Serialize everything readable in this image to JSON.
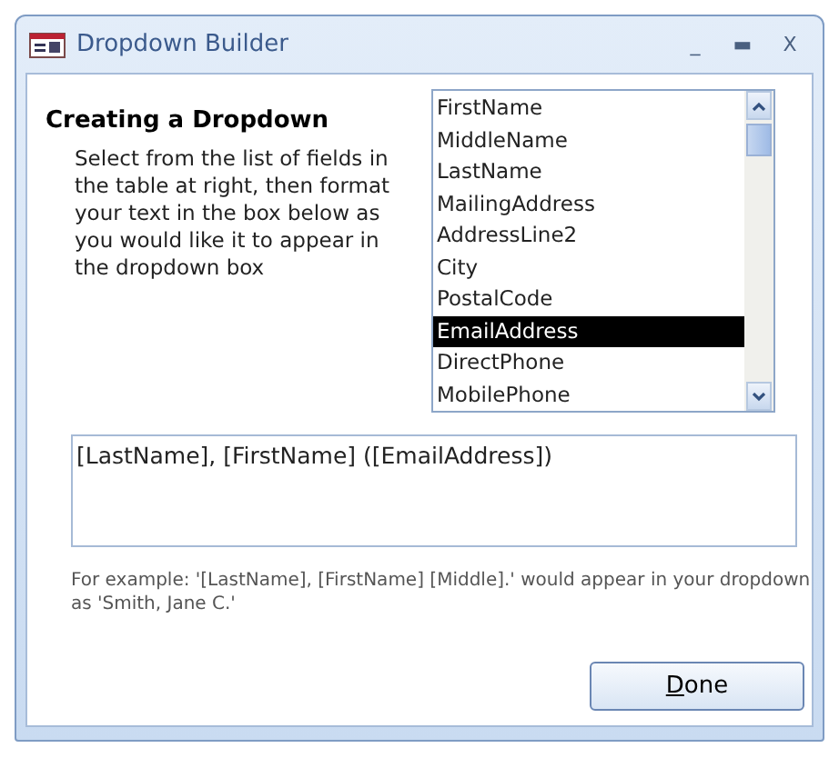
{
  "window": {
    "title": "Dropdown Builder",
    "controls": [
      "_",
      "▬",
      "X"
    ]
  },
  "heading": "Creating a Dropdown",
  "instructions": "Select from the list of fields in the table at right, then format your text in the box below as you would like it to appear in the dropdown box",
  "fields": [
    {
      "label": "FirstName",
      "selected": false
    },
    {
      "label": "MiddleName",
      "selected": false
    },
    {
      "label": "LastName",
      "selected": false
    },
    {
      "label": "MailingAddress",
      "selected": false
    },
    {
      "label": "AddressLine2",
      "selected": false
    },
    {
      "label": "City",
      "selected": false
    },
    {
      "label": "PostalCode",
      "selected": false
    },
    {
      "label": "EmailAddress",
      "selected": true
    },
    {
      "label": "DirectPhone",
      "selected": false
    },
    {
      "label": "MobilePhone",
      "selected": false
    }
  ],
  "format": {
    "value": "[LastName], [FirstName] ([EmailAddress])"
  },
  "example": "For example:   '[LastName], [FirstName] [Middle].' would appear in your dropdown as 'Smith, Jane C.'",
  "buttons": [
    {
      "label": "Done"
    }
  ]
}
